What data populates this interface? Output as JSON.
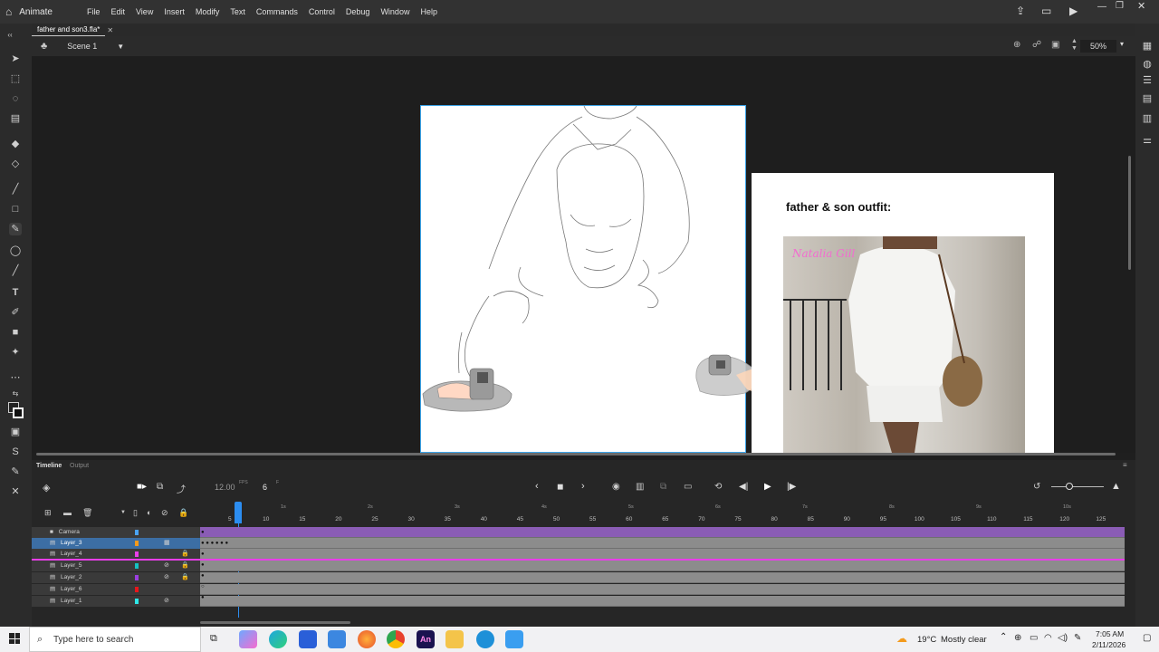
{
  "app": {
    "name": "Animate"
  },
  "menu": [
    "File",
    "Edit",
    "View",
    "Insert",
    "Modify",
    "Text",
    "Commands",
    "Control",
    "Debug",
    "Window",
    "Help"
  ],
  "document": {
    "tab_title": "father and son3.fla*",
    "scene": "Scene 1",
    "zoom": "50%"
  },
  "stage": {
    "reference_title": "father & son outfit:",
    "watermark_text": "Natalia Gill"
  },
  "timeline": {
    "panel_tabs": [
      "Timeline",
      "Output"
    ],
    "fps": "12.00",
    "fps_unit": "FPS",
    "current_frame": "6",
    "frame_unit": "F",
    "layers": [
      {
        "name": "Camera",
        "color": "#4aa3f5"
      },
      {
        "name": "Layer_3",
        "color": "#f59a1c"
      },
      {
        "name": "Layer_4",
        "color": "#e83ee8"
      },
      {
        "name": "Layer_5",
        "color": "#15c2c2"
      },
      {
        "name": "Layer_2",
        "color": "#9b3fe0"
      },
      {
        "name": "Layer_6",
        "color": "#e8161b"
      },
      {
        "name": "Layer_1",
        "color": "#2ee8e8"
      }
    ],
    "frame_numbers": [
      "5",
      "10",
      "15",
      "20",
      "25",
      "30",
      "35",
      "40",
      "45",
      "50",
      "55",
      "60",
      "65",
      "70",
      "75",
      "80",
      "85",
      "90",
      "95",
      "100",
      "105",
      "110",
      "115",
      "120",
      "125"
    ],
    "seconds_markers": [
      "1s",
      "2s",
      "3s",
      "4s",
      "5s",
      "6s",
      "7s",
      "8s",
      "9s",
      "10s"
    ]
  },
  "taskbar": {
    "search_placeholder": "Type here to search",
    "weather_temp": "19°C",
    "weather_desc": "Mostly clear",
    "time": "7:05 AM",
    "date": "2/11/2026"
  },
  "colors": {
    "accent": "#2c8df0",
    "timeline_bar": "#8c8c8c",
    "camera_bar": "#8a5cb5",
    "highlight_row": "#3c6ea4"
  }
}
